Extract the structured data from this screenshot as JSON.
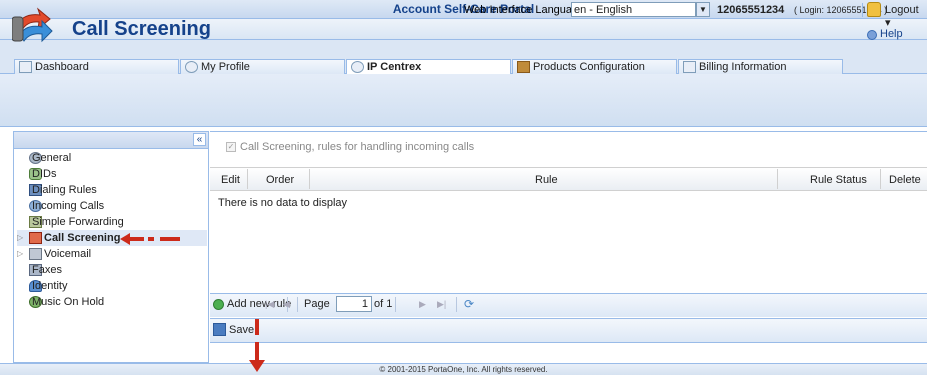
{
  "window": {
    "title": "Account Self-Care Portal"
  },
  "topbar": {
    "language_label": "Web Interface Language:",
    "language_value": "en - English",
    "account": "12065551234",
    "login_info": "( Login: 12065551234 )",
    "logout_label": "Logout ▾"
  },
  "tabs": [
    {
      "label": "Dashboard",
      "icon": "dashboard-icon",
      "active": false
    },
    {
      "label": "My Profile",
      "icon": "profile-icon",
      "active": false
    },
    {
      "label": "IP Centrex",
      "icon": "gear-icon",
      "active": true
    },
    {
      "label": "Products Configuration",
      "icon": "products-icon",
      "active": false
    },
    {
      "label": "Billing Information",
      "icon": "document-icon",
      "active": false
    }
  ],
  "header": {
    "title": "Call Screening",
    "help_label": "Help"
  },
  "sidebar": {
    "collapse_label": "«",
    "items": [
      {
        "label": "General",
        "icon": "gear-icon"
      },
      {
        "label": "DIDs",
        "icon": "dids-icon"
      },
      {
        "label": "Dialing Rules",
        "icon": "dialing-rules-icon"
      },
      {
        "label": "Incoming Calls",
        "icon": "incoming-calls-icon"
      },
      {
        "label": "Simple Forwarding",
        "icon": "forwarding-icon"
      },
      {
        "label": "Call Screening",
        "icon": "call-screening-icon",
        "selected": true,
        "expandable": true
      },
      {
        "label": "Voicemail",
        "icon": "voicemail-icon",
        "expandable": true
      },
      {
        "label": "Faxes",
        "icon": "fax-icon"
      },
      {
        "label": "Identity",
        "icon": "identity-icon"
      },
      {
        "label": "Music On Hold",
        "icon": "music-icon"
      }
    ]
  },
  "main": {
    "checkbox_label": "Call Screening, rules for handling incoming calls",
    "columns": [
      "Edit",
      "Order",
      "Rule",
      "Rule Status",
      "Delete"
    ],
    "empty_text": "There is no data to display",
    "paging": {
      "add_label": "Add new rule",
      "page_label": "Page",
      "page_value": "1",
      "of_label": "of 1"
    },
    "save_label": "Save"
  },
  "footer": {
    "text": "© 2001-2015 PortaOne, Inc. All rights reserved."
  },
  "colors": {
    "accent": "#15428b",
    "annotation": "#cc2a1a",
    "border": "#99bbe8"
  }
}
